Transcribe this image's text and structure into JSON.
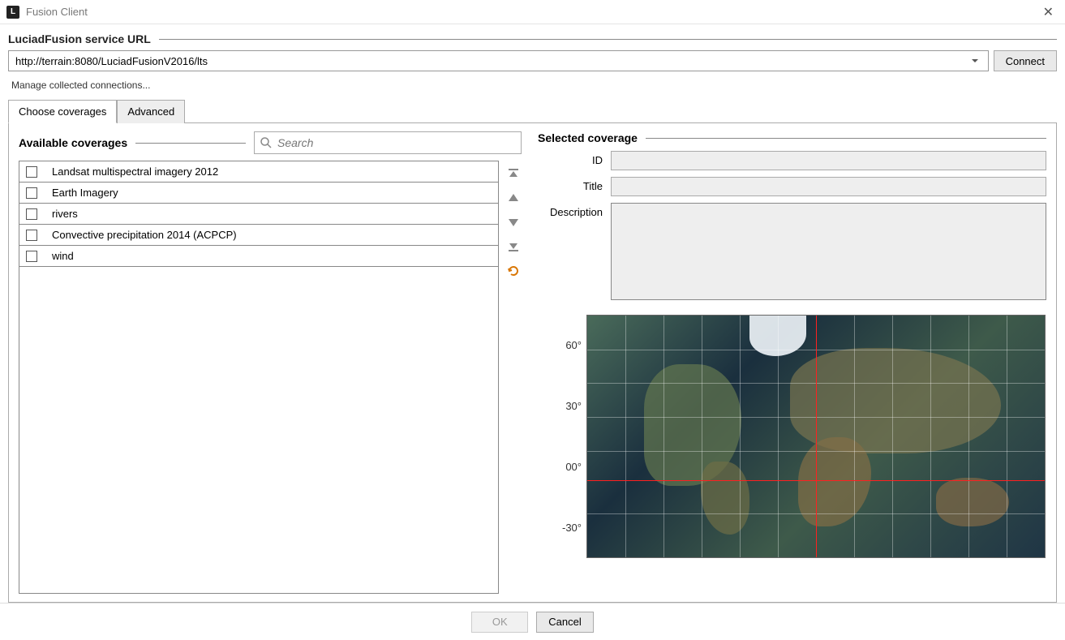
{
  "window": {
    "title": "Fusion Client",
    "appIconLetter": "L"
  },
  "sections": {
    "serviceUrl": {
      "label": "LuciadFusion service URL",
      "value": "http://terrain:8080/LuciadFusionV2016/lts",
      "connect": "Connect",
      "manageLink": "Manage collected connections..."
    },
    "tabs": {
      "choose": "Choose coverages",
      "advanced": "Advanced"
    },
    "available": {
      "label": "Available coverages",
      "searchPlaceholder": "Search",
      "items": [
        "Landsat multispectral imagery 2012",
        "Earth Imagery",
        "rivers",
        "Convective precipitation 2014 (ACPCP)",
        "wind"
      ]
    },
    "selected": {
      "label": "Selected coverage",
      "fields": {
        "id": "ID",
        "title": "Title",
        "description": "Description"
      },
      "values": {
        "id": "",
        "title": "",
        "description": ""
      }
    },
    "map": {
      "latLabels": [
        "60°",
        "30°",
        "00°",
        "-30°"
      ]
    }
  },
  "footer": {
    "ok": "OK",
    "cancel": "Cancel"
  }
}
